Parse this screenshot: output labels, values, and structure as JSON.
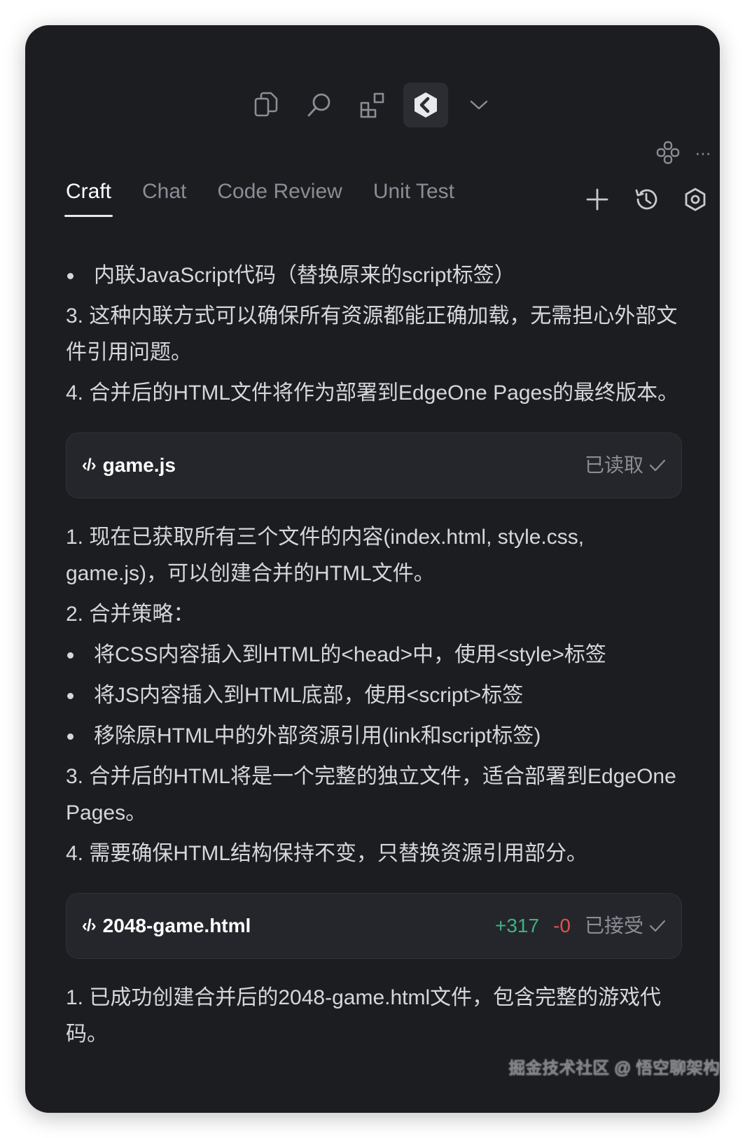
{
  "toolbar": {
    "icons": [
      "copy-icon",
      "search-icon",
      "extensions-icon",
      "codebuddy-logo-icon",
      "chevron-down-icon"
    ]
  },
  "topright": {
    "more_label": "···"
  },
  "tabs": [
    {
      "label": "Craft",
      "active": true
    },
    {
      "label": "Chat",
      "active": false
    },
    {
      "label": "Code Review",
      "active": false
    },
    {
      "label": "Unit Test",
      "active": false
    }
  ],
  "content": {
    "block1": {
      "bullet": "内联JavaScript代码（替换原来的script标签）",
      "p3": "3. 这种内联方式可以确保所有资源都能正确加载，无需担心外部文件引用问题。",
      "p4": "4. 合并后的HTML文件将作为部署到EdgeOne Pages的最终版本。"
    },
    "card1": {
      "icon_text": "‹/›",
      "filename": "game.js",
      "status": "已读取"
    },
    "block2": {
      "p1": "1. 现在已获取所有三个文件的内容(index.html, style.css, game.js)，可以创建合并的HTML文件。",
      "p2": "2. 合并策略：",
      "bullets": [
        "将CSS内容插入到HTML的<head>中，使用<style>标签",
        "将JS内容插入到HTML底部，使用<script>标签",
        "移除原HTML中的外部资源引用(link和script标签)"
      ],
      "p3": "3. 合并后的HTML将是一个完整的独立文件，适合部署到EdgeOne Pages。",
      "p4": "4. 需要确保HTML结构保持不变，只替换资源引用部分。"
    },
    "card2": {
      "icon_text": "‹/›",
      "filename": "2048-game.html",
      "additions": "+317",
      "deletions": "-0",
      "status": "已接受"
    },
    "block3": {
      "p1": "1. 已成功创建合并后的2048-game.html文件，包含完整的游戏代码。"
    }
  },
  "watermark": "掘金技术社区 @ 悟空聊架构",
  "colors": {
    "panel_bg": "#1c1d21",
    "card_bg": "#25262b",
    "add": "#3fb27f",
    "del": "#e0524d"
  }
}
